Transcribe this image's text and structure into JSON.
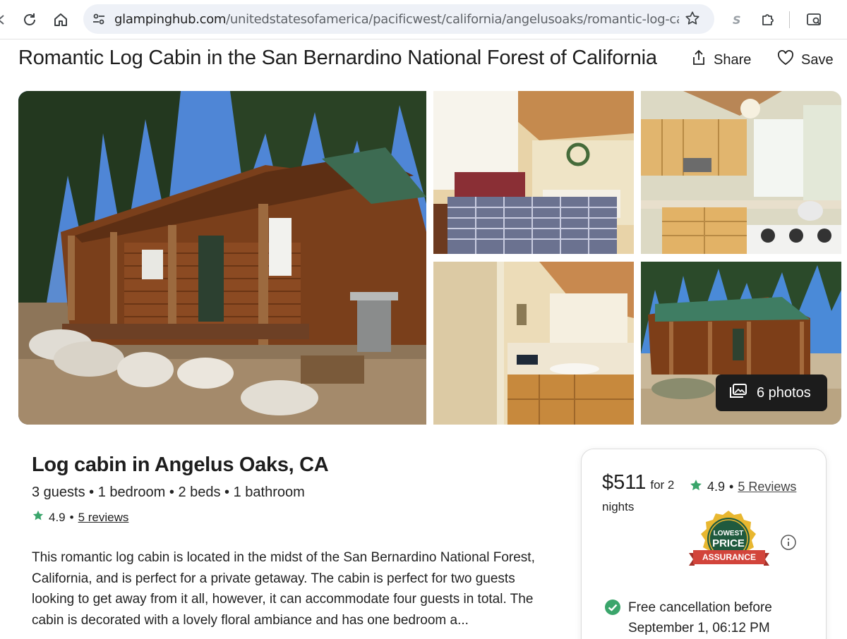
{
  "browser": {
    "url_domain": "glampinghub.com",
    "url_path": "/unitedstatesofamerica/pacificwest/california/angelusoaks/romantic-log-cabin-s..."
  },
  "listing": {
    "title": "Romantic Log Cabin in the San Bernardino National Forest of California",
    "share_label": "Share",
    "save_label": "Save",
    "photos_label": "6 photos",
    "subtitle": "Log cabin in Angelus Oaks, CA",
    "specs": "3 guests • 1 bedroom • 2 beds • 1 bathroom",
    "rating": "4.9",
    "separator": "•",
    "reviews_label": "5 reviews",
    "description": "This romantic log cabin is located in the midst of the San Bernardino National Forest, California, and is perfect for a private getaway. The cabin is perfect for two guests looking to get away from it all, however, it can accommodate four guests in total. The cabin is decorated with a lovely floral ambiance and has one bedroom a..."
  },
  "booking": {
    "price": "$511",
    "price_for": "for 2",
    "price_nights": "nights",
    "rating": "4.9",
    "separator": "•",
    "reviews_label": "5 Reviews",
    "badge_top": "LOWEST",
    "badge_main": "PRICE",
    "badge_ribbon": "ASSURANCE",
    "cancel_line1": "Free cancellation before",
    "cancel_line2": "September 1, 06:12 PM"
  },
  "colors": {
    "star": "#3aa56b",
    "check": "#3aa56b",
    "badge_gold": "#e8b730",
    "badge_green": "#1f5a3e",
    "badge_ribbon": "#d2443b"
  }
}
